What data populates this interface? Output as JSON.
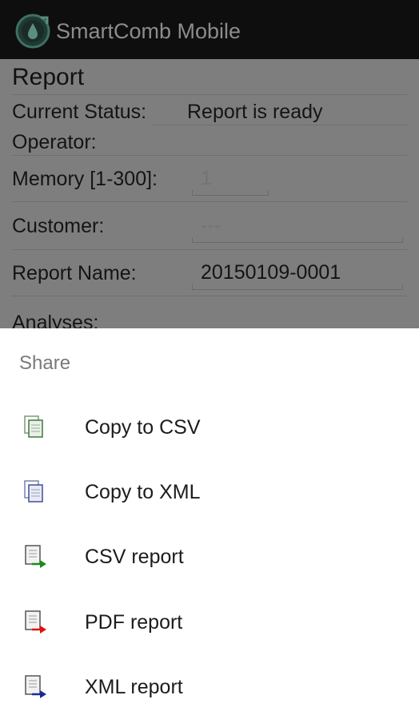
{
  "app": {
    "title": "SmartComb Mobile",
    "icon": "smartcomb-logo"
  },
  "report": {
    "heading": "Report",
    "current_status_label": "Current Status:",
    "current_status_value": "Report is ready",
    "operator_label": "Operator:",
    "memory_label": "Memory [1-300]:",
    "memory_value": "1",
    "customer_label": "Customer:",
    "customer_value": "---",
    "report_name_label": "Report Name:",
    "report_name_value": "20150109-0001",
    "analyses_label": "Analyses:"
  },
  "share": {
    "title": "Share",
    "items": [
      {
        "label": "Copy to CSV",
        "icon": "copy-csv-icon",
        "accent": "#3a7a3a"
      },
      {
        "label": "Copy to XML",
        "icon": "copy-xml-icon",
        "accent": "#3f4f9a"
      },
      {
        "label": "CSV report",
        "icon": "csv-report-icon",
        "accent": "#1a8a1a"
      },
      {
        "label": "PDF report",
        "icon": "pdf-report-icon",
        "accent": "#e01010"
      },
      {
        "label": "XML report",
        "icon": "xml-report-icon",
        "accent": "#1a2a9a"
      }
    ]
  },
  "colors": {
    "appbar": "#0e0e0e",
    "dim_overlay": "#7e7e7e",
    "sheet": "#ffffff"
  }
}
